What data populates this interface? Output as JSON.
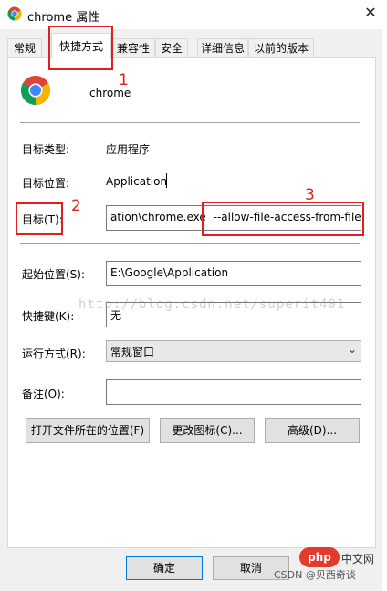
{
  "window": {
    "title": "chrome 属性",
    "close": "✕"
  },
  "tabs": [
    {
      "label": "常规"
    },
    {
      "label": "快捷方式"
    },
    {
      "label": "兼容性"
    },
    {
      "label": "安全"
    },
    {
      "label": "详细信息"
    },
    {
      "label": "以前的版本"
    }
  ],
  "shortcut": {
    "app_name": "chrome",
    "target_type_label": "目标类型:",
    "target_type_value": "应用程序",
    "target_location_label": "目标位置:",
    "target_location_value": "Application",
    "target_label": "目标(T):",
    "target_value_prefix": "ation\\chrome.exe",
    "target_value_args": "--allow-file-access-from-files",
    "start_in_label": "起始位置(S):",
    "start_in_value": "E:\\Google\\Application",
    "hotkey_label": "快捷键(K):",
    "hotkey_value": "无",
    "run_label": "运行方式(R):",
    "run_value": "常规窗口",
    "comment_label": "备注(O):",
    "comment_value": ""
  },
  "buttons": {
    "open_location": "打开文件所在的位置(F)",
    "change_icon": "更改图标(C)...",
    "advanced": "高级(D)...",
    "ok": "确定",
    "cancel": "取消"
  },
  "annotations": {
    "n1": "1",
    "n2": "2",
    "n3": "3"
  },
  "watermarks": {
    "blog": "http://blog.csdn.net/superit401",
    "php": "php",
    "php_cn": "中文网",
    "csdn": "CSDN @贝西奇谈"
  },
  "colors": {
    "annotation": "#e02020",
    "chrome_red": "#db4437",
    "chrome_green": "#0f9d58",
    "chrome_yellow": "#f4b400",
    "chrome_blue": "#4285f4"
  }
}
